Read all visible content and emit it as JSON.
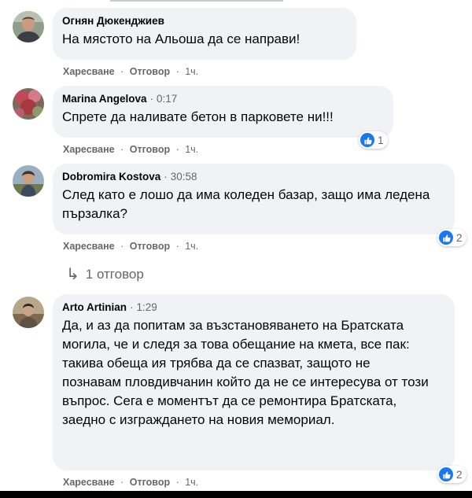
{
  "comments": [
    {
      "author": "Огнян Дюкенджиев",
      "timestamp": "",
      "text": "На мястото на Альоша да се направи!",
      "like_label": "Харесване",
      "reply_label": "Отговор",
      "time": "1ч.",
      "reactions": ""
    },
    {
      "author": "Marina Angelova",
      "timestamp": "0:17",
      "text": "Спрете да наливате бетон в парковете ни!!!",
      "like_label": "Харесване",
      "reply_label": "Отговор",
      "time": "1ч.",
      "reactions": "1"
    },
    {
      "author": "Dobromira Kostova",
      "timestamp": "30:58",
      "text": "След като е лошо да има коледен базар, защо има ледена пързалка?",
      "like_label": "Харесване",
      "reply_label": "Отговор",
      "time": "1ч.",
      "reactions": "2",
      "replies_link": "1 отговор"
    },
    {
      "author": "Arto Artinian",
      "timestamp": "1:29",
      "text": "Да, и аз да попитам за възстановяването на Братската могила, че и следя за това обещание на кмета, все пак: такива обеща ия трябва да се спазват, защото не познавам пловдивчанин който да не се интересува от този въпрос. Сега е моментът да се ремонтира Братската, заедно с изграждането на новия мемориал.",
      "like_label": "Харесване",
      "reply_label": "Отговор",
      "time": "1ч.",
      "reactions": "2"
    }
  ],
  "colors": {
    "bubble": "#f0f2f5",
    "secondary_text": "#65676b",
    "like_blue": "#1877f2"
  }
}
